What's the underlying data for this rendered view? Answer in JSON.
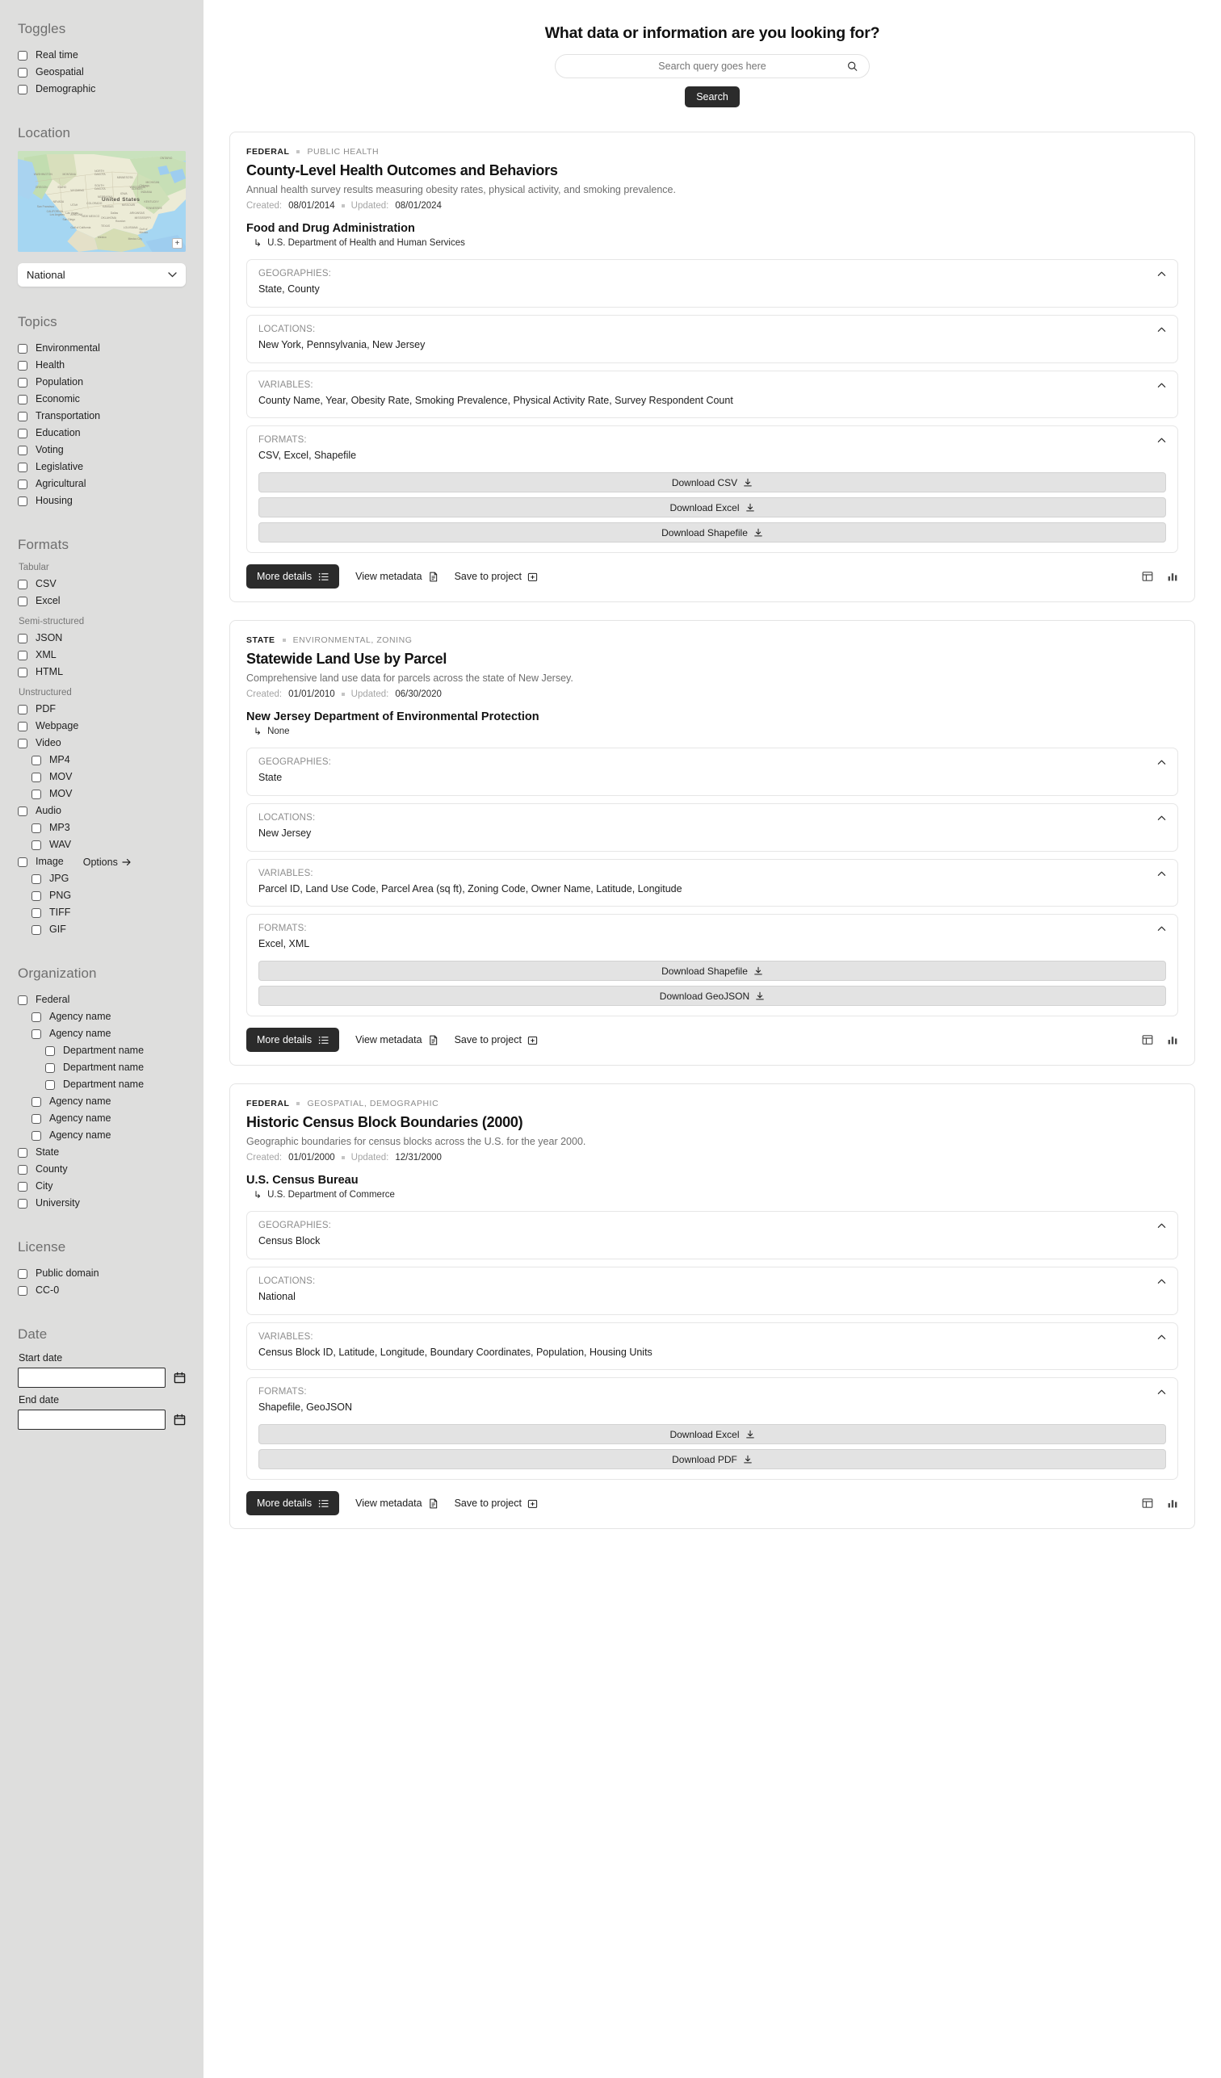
{
  "sidebar": {
    "toggles": {
      "title": "Toggles",
      "items": [
        {
          "label": "Real time"
        },
        {
          "label": "Geospatial"
        },
        {
          "label": "Demographic"
        }
      ]
    },
    "location": {
      "title": "Location",
      "map_label": "United States",
      "zoom_icon": "+",
      "selected": "National"
    },
    "topics": {
      "title": "Topics",
      "items": [
        {
          "label": "Environmental"
        },
        {
          "label": "Health"
        },
        {
          "label": "Population"
        },
        {
          "label": "Economic"
        },
        {
          "label": "Transportation"
        },
        {
          "label": "Education"
        },
        {
          "label": "Voting"
        },
        {
          "label": "Legislative"
        },
        {
          "label": "Agricultural"
        },
        {
          "label": "Housing"
        }
      ]
    },
    "formats": {
      "title": "Formats",
      "groups": [
        {
          "label": "Tabular",
          "items": [
            {
              "label": "CSV",
              "indent": 0
            },
            {
              "label": "Excel",
              "indent": 0
            }
          ]
        },
        {
          "label": "Semi-structured",
          "items": [
            {
              "label": "JSON",
              "indent": 0
            },
            {
              "label": "XML",
              "indent": 0
            },
            {
              "label": "HTML",
              "indent": 0
            }
          ]
        },
        {
          "label": "Unstructured",
          "items": [
            {
              "label": "PDF",
              "indent": 0
            },
            {
              "label": "Webpage",
              "indent": 0
            },
            {
              "label": "Video",
              "indent": 0
            },
            {
              "label": "MP4",
              "indent": 1
            },
            {
              "label": "MOV",
              "indent": 1
            },
            {
              "label": "MOV",
              "indent": 1
            },
            {
              "label": "Audio",
              "indent": 0
            },
            {
              "label": "MP3",
              "indent": 1
            },
            {
              "label": "WAV",
              "indent": 1
            },
            {
              "label": "Image",
              "indent": 0,
              "options": "Options"
            },
            {
              "label": "JPG",
              "indent": 1
            },
            {
              "label": "PNG",
              "indent": 1
            },
            {
              "label": "TIFF",
              "indent": 1
            },
            {
              "label": "GIF",
              "indent": 1
            }
          ]
        }
      ]
    },
    "organization": {
      "title": "Organization",
      "items": [
        {
          "label": "Federal",
          "indent": 0
        },
        {
          "label": "Agency name",
          "indent": 1
        },
        {
          "label": "Agency name",
          "indent": 1
        },
        {
          "label": "Department name",
          "indent": 2
        },
        {
          "label": "Department name",
          "indent": 2
        },
        {
          "label": "Department name",
          "indent": 2
        },
        {
          "label": "Agency name",
          "indent": 1
        },
        {
          "label": "Agency name",
          "indent": 1
        },
        {
          "label": "Agency name",
          "indent": 1
        },
        {
          "label": "State",
          "indent": 0
        },
        {
          "label": "County",
          "indent": 0
        },
        {
          "label": "City",
          "indent": 0
        },
        {
          "label": "University",
          "indent": 0
        }
      ]
    },
    "license": {
      "title": "License",
      "items": [
        {
          "label": "Public domain"
        },
        {
          "label": "CC-0"
        }
      ]
    },
    "date": {
      "title": "Date",
      "start_label": "Start date",
      "start_value": "",
      "end_label": "End date",
      "end_value": ""
    }
  },
  "header": {
    "title": "What data or information are you looking for?",
    "search_placeholder": "Search query goes here",
    "search_value": "",
    "search_button": "Search"
  },
  "results": [
    {
      "tag_primary": "FEDERAL",
      "tag_secondary": "PUBLIC HEALTH",
      "title": "County-Level Health Outcomes and Behaviors",
      "description": "Annual health survey results measuring obesity rates, physical activity, and smoking prevalence.",
      "created_label": "Created:",
      "created": "08/01/2014",
      "updated_label": "Updated:",
      "updated": "08/01/2024",
      "org": "Food and Drug Administration",
      "org_parent": "U.S. Department of Health and Human Services",
      "sections": [
        {
          "label": "GEOGRAPHIES:",
          "value": "State, County"
        },
        {
          "label": "LOCATIONS:",
          "value": "New York, Pennsylvania, New Jersey"
        },
        {
          "label": "VARIABLES:",
          "value": "County Name, Year, Obesity Rate, Smoking Prevalence, Physical Activity Rate, Survey Respondent Count"
        },
        {
          "label": "FORMATS:",
          "value": "CSV, Excel, Shapefile",
          "downloads": [
            "Download CSV",
            "Download Excel",
            "Download Shapefile"
          ]
        }
      ],
      "more_details": "More details",
      "view_metadata": "View metadata",
      "save_to_project": "Save to project"
    },
    {
      "tag_primary": "STATE",
      "tag_secondary": "ENVIRONMENTAL, ZONING",
      "title": "Statewide Land Use by Parcel",
      "description": "Comprehensive land use data for parcels across the state of New Jersey.",
      "created_label": "Created:",
      "created": "01/01/2010",
      "updated_label": "Updated:",
      "updated": "06/30/2020",
      "org": "New Jersey Department of Environmental Protection",
      "org_parent": "None",
      "sections": [
        {
          "label": "GEOGRAPHIES:",
          "value": "State"
        },
        {
          "label": "LOCATIONS:",
          "value": "New Jersey"
        },
        {
          "label": "VARIABLES:",
          "value": "Parcel ID, Land Use Code, Parcel Area (sq ft), Zoning Code, Owner Name, Latitude, Longitude"
        },
        {
          "label": "FORMATS:",
          "value": "Excel, XML",
          "downloads": [
            "Download Shapefile",
            "Download GeoJSON"
          ]
        }
      ],
      "more_details": "More details",
      "view_metadata": "View metadata",
      "save_to_project": "Save to project"
    },
    {
      "tag_primary": "FEDERAL",
      "tag_secondary": "GEOSPATIAL, DEMOGRAPHIC",
      "title": "Historic Census Block Boundaries (2000)",
      "description": "Geographic boundaries for census blocks across the U.S. for the year 2000.",
      "created_label": "Created:",
      "created": "01/01/2000",
      "updated_label": "Updated:",
      "updated": "12/31/2000",
      "org": "U.S. Census Bureau",
      "org_parent": "U.S. Department of Commerce",
      "sections": [
        {
          "label": "GEOGRAPHIES:",
          "value": "Census Block"
        },
        {
          "label": "LOCATIONS:",
          "value": "National"
        },
        {
          "label": "VARIABLES:",
          "value": "Census Block ID, Latitude, Longitude, Boundary Coordinates, Population, Housing Units"
        },
        {
          "label": "FORMATS:",
          "value": "Shapefile, GeoJSON",
          "downloads": [
            "Download Excel",
            "Download PDF"
          ]
        }
      ],
      "more_details": "More details",
      "view_metadata": "View metadata",
      "save_to_project": "Save to project"
    }
  ]
}
